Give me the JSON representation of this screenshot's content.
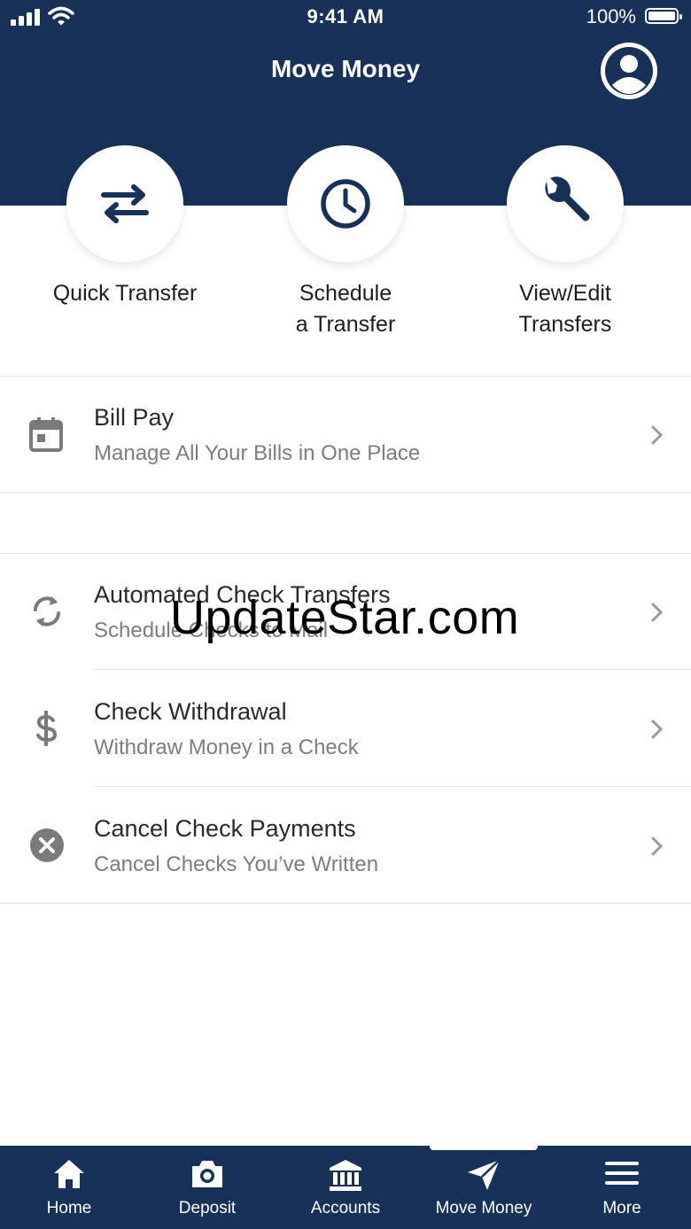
{
  "status_bar": {
    "time": "9:41 AM",
    "battery": "100%"
  },
  "header": {
    "title": "Move Money"
  },
  "actions": [
    {
      "label": "Quick Transfer",
      "icon": "transfer-arrows-icon"
    },
    {
      "label": "Schedule\na Transfer",
      "icon": "clock-icon"
    },
    {
      "label": "View/Edit\nTransfers",
      "icon": "wrench-icon"
    }
  ],
  "menu": [
    {
      "title": "Bill Pay",
      "subtitle": "Manage All Your Bills in One Place",
      "icon": "calendar-icon"
    },
    {
      "title": "Automated Check Transfers",
      "subtitle": "Schedule Checks to Mail",
      "icon": "refresh-icon"
    },
    {
      "title": "Check Withdrawal",
      "subtitle": "Withdraw Money in a Check",
      "icon": "dollar-icon"
    },
    {
      "title": "Cancel Check Payments",
      "subtitle": "Cancel Checks You’ve Written",
      "icon": "cancel-circle-icon"
    }
  ],
  "watermark": "UpdateStar.com",
  "tabs": [
    {
      "label": "Home",
      "icon": "home-icon"
    },
    {
      "label": "Deposit",
      "icon": "camera-icon"
    },
    {
      "label": "Accounts",
      "icon": "bank-icon"
    },
    {
      "label": "Move Money",
      "icon": "paper-plane-icon",
      "active": true
    },
    {
      "label": "More",
      "icon": "menu-icon"
    }
  ],
  "colors": {
    "brand_navy": "#173158",
    "text_secondary": "#7d7d7d",
    "divider": "#e4e4e4"
  }
}
